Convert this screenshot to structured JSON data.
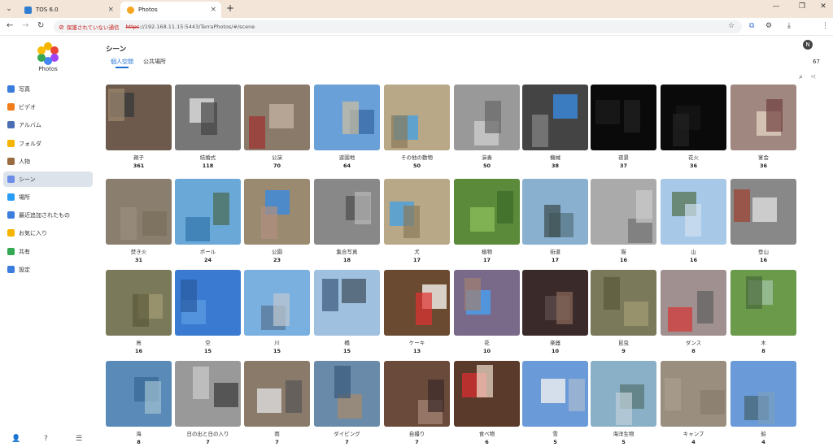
{
  "browser": {
    "tabs": [
      {
        "title": "TOS 6.0",
        "icon_color": "#2f7dd1"
      },
      {
        "title": "Photos",
        "icon_color": "#f5a623"
      }
    ],
    "url": {
      "warning": "保護されていない通信",
      "scheme": "https",
      "rest": "://192.168.11.15:5443/TerraPhotos/#/scene"
    },
    "profile_initial": "N"
  },
  "app": {
    "logo_text": "Photos",
    "nav": [
      {
        "label": "写真",
        "icon": "photo-icon",
        "color": "#3b7ddd"
      },
      {
        "label": "ビデオ",
        "icon": "video-icon",
        "color": "#f07c1b"
      },
      {
        "label": "アルバム",
        "icon": "album-icon",
        "color": "#4a6fb5"
      },
      {
        "label": "フォルダ",
        "icon": "folder-icon",
        "color": "#f4b400"
      },
      {
        "label": "人物",
        "icon": "person-icon",
        "color": "#9a6b3f"
      },
      {
        "label": "シーン",
        "icon": "scene-icon",
        "color": "#6c8ee8"
      },
      {
        "label": "場所",
        "icon": "location-icon",
        "color": "#2a9df4"
      },
      {
        "label": "最近追加されたもの",
        "icon": "recent-icon",
        "color": "#3b7ddd"
      },
      {
        "label": "お気に入り",
        "icon": "favorite-icon",
        "color": "#f4b400"
      },
      {
        "label": "共有",
        "icon": "share-icon",
        "color": "#34a853"
      },
      {
        "label": "設定",
        "icon": "settings-icon",
        "color": "#3b7ddd"
      }
    ],
    "active_nav": "シーン"
  },
  "main": {
    "title": "シーン",
    "subtabs": [
      "個人空間",
      "公共場所"
    ],
    "count": "67",
    "scenes": [
      {
        "label": "親子",
        "count": "361",
        "c": [
          "#6d5a4c",
          "#3a3a3a",
          "#a08a70"
        ]
      },
      {
        "label": "結婚式",
        "count": "118",
        "c": [
          "#777",
          "#ddd",
          "#444"
        ]
      },
      {
        "label": "公演",
        "count": "70",
        "c": [
          "#8a7a6a",
          "#c0b0a0",
          "#a03030"
        ]
      },
      {
        "label": "遊園地",
        "count": "64",
        "c": [
          "#6aa0d8",
          "#3b6ca8",
          "#d0c0a0"
        ]
      },
      {
        "label": "その他の動物",
        "count": "50",
        "c": [
          "#b8a888",
          "#4aa0e0",
          "#8a7a5a"
        ]
      },
      {
        "label": "演奏",
        "count": "50",
        "c": [
          "#999",
          "#ccc",
          "#666"
        ]
      },
      {
        "label": "機械",
        "count": "38",
        "c": [
          "#444",
          "#3a8ae0",
          "#888"
        ]
      },
      {
        "label": "夜景",
        "count": "37",
        "c": [
          "#0a0a0a",
          "#1a1a1a",
          "#222"
        ]
      },
      {
        "label": "花火",
        "count": "36",
        "c": [
          "#0a0a0a",
          "#151515",
          "#222"
        ]
      },
      {
        "label": "宴会",
        "count": "36",
        "c": [
          "#a08880",
          "#e0d0c0",
          "#704040"
        ]
      },
      {
        "label": "焚き火",
        "count": "31",
        "c": [
          "#8a7f6e",
          "#7a6f5e",
          "#9a8f7e"
        ]
      },
      {
        "label": "ボール",
        "count": "24",
        "c": [
          "#6aa8d8",
          "#3a7ab0",
          "#4a6a50"
        ]
      },
      {
        "label": "公園",
        "count": "23",
        "c": [
          "#9a8a70",
          "#3a8ae0",
          "#b09080"
        ]
      },
      {
        "label": "集合写真",
        "count": "18",
        "c": [
          "#888",
          "#555",
          "#bbb"
        ]
      },
      {
        "label": "犬",
        "count": "17",
        "c": [
          "#b8a888",
          "#4aa0e0",
          "#8a7a5a"
        ]
      },
      {
        "label": "植物",
        "count": "17",
        "c": [
          "#5a8a3a",
          "#8aba5a",
          "#3a6a2a"
        ]
      },
      {
        "label": "街道",
        "count": "17",
        "c": [
          "#8ab0d0",
          "#5a7a8a",
          "#3a4a4a"
        ]
      },
      {
        "label": "猫",
        "count": "16",
        "c": [
          "#aaa",
          "#777",
          "#ccc"
        ]
      },
      {
        "label": "山",
        "count": "16",
        "c": [
          "#a8c8e8",
          "#5a7a5a",
          "#d0e0f0"
        ]
      },
      {
        "label": "登山",
        "count": "16",
        "c": [
          "#888",
          "#ddd",
          "#a04030"
        ]
      },
      {
        "label": "鳥",
        "count": "16",
        "c": [
          "#7a7a5a",
          "#a09870",
          "#5a5a3a"
        ]
      },
      {
        "label": "空",
        "count": "15",
        "c": [
          "#3a7ad0",
          "#5a9ae0",
          "#2a5aa0"
        ]
      },
      {
        "label": "川",
        "count": "15",
        "c": [
          "#7ab0e0",
          "#5a7a9a",
          "#c0c8d0"
        ]
      },
      {
        "label": "橋",
        "count": "15",
        "c": [
          "#a0c0e0",
          "#4a5a6a",
          "#3a5a7a"
        ]
      },
      {
        "label": "ケーキ",
        "count": "13",
        "c": [
          "#6a4a30",
          "#f4f0ec",
          "#e03030"
        ]
      },
      {
        "label": "花",
        "count": "10",
        "c": [
          "#7a6a8a",
          "#4aa0f0",
          "#a08070"
        ]
      },
      {
        "label": "楽器",
        "count": "10",
        "c": [
          "#3a2a2a",
          "#5a4a4a",
          "#8a6a5a"
        ]
      },
      {
        "label": "昆虫",
        "count": "9",
        "c": [
          "#7a7a5a",
          "#a09870",
          "#5a5a3a"
        ]
      },
      {
        "label": "ダンス",
        "count": "8",
        "c": [
          "#a09090",
          "#d04040",
          "#606060"
        ]
      },
      {
        "label": "木",
        "count": "8",
        "c": [
          "#6a9a4a",
          "#a0c0a0",
          "#4a6a3a"
        ]
      },
      {
        "label": "海",
        "count": "8",
        "c": [
          "#5a8ab8",
          "#3a6a98",
          "#a0c0d0"
        ]
      },
      {
        "label": "日の出と日の入り",
        "count": "7",
        "c": [
          "#999",
          "#444",
          "#ccc"
        ]
      },
      {
        "label": "雨",
        "count": "7",
        "c": [
          "#8a7a6a",
          "#ddd",
          "#555"
        ]
      },
      {
        "label": "ダイビング",
        "count": "7",
        "c": [
          "#6a8aaa",
          "#a08a70",
          "#3a5a7a"
        ]
      },
      {
        "label": "自撮り",
        "count": "7",
        "c": [
          "#6a4a3a",
          "#a08070",
          "#3a2a2a"
        ]
      },
      {
        "label": "食べ物",
        "count": "6",
        "c": [
          "#5a3a2a",
          "#d03030",
          "#f0e0d0"
        ]
      },
      {
        "label": "雪",
        "count": "5",
        "c": [
          "#6a9ad8",
          "#f0f0f0",
          "#aabbd0"
        ]
      },
      {
        "label": "海洋生物",
        "count": "5",
        "c": [
          "#8ab0c8",
          "#5a7a7a",
          "#c0d0d8"
        ]
      },
      {
        "label": "キャンプ",
        "count": "4",
        "c": [
          "#9a8e7e",
          "#8a7e6e",
          "#aaa090"
        ]
      },
      {
        "label": "船",
        "count": "4",
        "c": [
          "#6a9ad8",
          "#4a6a7a",
          "#7aa0c0"
        ]
      }
    ]
  }
}
